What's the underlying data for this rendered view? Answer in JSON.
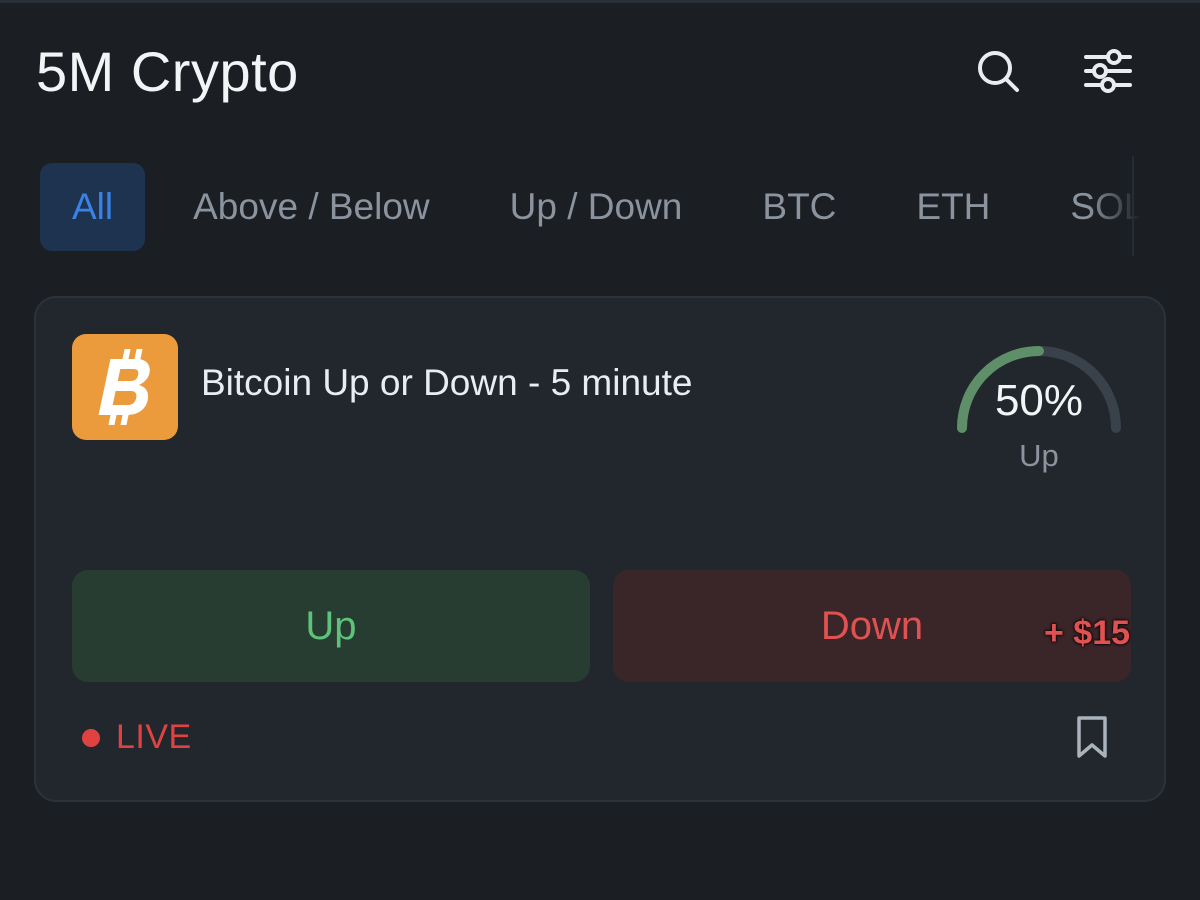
{
  "header": {
    "title": "5M Crypto",
    "search_icon": "search-icon",
    "filter_icon": "sliders-icon"
  },
  "tabs": [
    {
      "label": "All",
      "active": true
    },
    {
      "label": "Above / Below",
      "active": false
    },
    {
      "label": "Up / Down",
      "active": false
    },
    {
      "label": "BTC",
      "active": false
    },
    {
      "label": "ETH",
      "active": false
    },
    {
      "label": "SOL",
      "active": false
    }
  ],
  "market": {
    "coin_icon": "bitcoin-icon",
    "title": "Bitcoin Up or Down - 5 minute",
    "probability": {
      "value": 50,
      "display": "50%",
      "label": "Up"
    },
    "buttons": {
      "up_label": "Up",
      "down_label": "Down"
    },
    "pnl_badge": "+ $15",
    "status": "LIVE",
    "bookmark_icon": "bookmark-icon"
  },
  "colors": {
    "background": "#1b1f24",
    "card": "#22272d",
    "accent": "#3b82e6",
    "up": "#5fc27a",
    "down": "#e05151",
    "bitcoin": "#eb9a3c"
  }
}
